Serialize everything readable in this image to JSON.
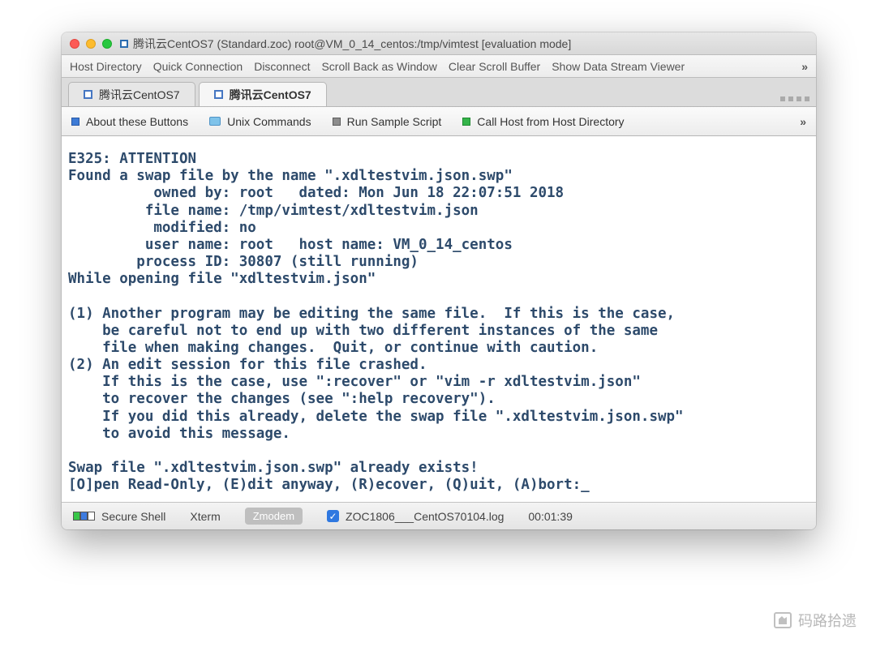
{
  "window": {
    "title": "腾讯云CentOS7 (Standard.zoc) root@VM_0_14_centos:/tmp/vimtest [evaluation mode]"
  },
  "menubar": {
    "items": [
      "Host Directory",
      "Quick Connection",
      "Disconnect",
      "Scroll Back as Window",
      "Clear Scroll Buffer",
      "Show Data Stream Viewer"
    ],
    "more": "»"
  },
  "tabs": {
    "list": [
      {
        "label": "腾讯云CentOS7",
        "active": false
      },
      {
        "label": "腾讯云CentOS7",
        "active": true
      }
    ]
  },
  "button_row": {
    "items": [
      {
        "label": "About these Buttons",
        "icon": "blue"
      },
      {
        "label": "Unix Commands",
        "icon": "folder"
      },
      {
        "label": "Run Sample Script",
        "icon": "gray"
      },
      {
        "label": "Call Host from Host Directory",
        "icon": "green"
      }
    ],
    "more": "»"
  },
  "terminal_text": "E325: ATTENTION\nFound a swap file by the name \".xdltestvim.json.swp\"\n          owned by: root   dated: Mon Jun 18 22:07:51 2018\n         file name: /tmp/vimtest/xdltestvim.json\n          modified: no\n         user name: root   host name: VM_0_14_centos\n        process ID: 30807 (still running)\nWhile opening file \"xdltestvim.json\"\n\n(1) Another program may be editing the same file.  If this is the case,\n    be careful not to end up with two different instances of the same\n    file when making changes.  Quit, or continue with caution.\n(2) An edit session for this file crashed.\n    If this is the case, use \":recover\" or \"vim -r xdltestvim.json\"\n    to recover the changes (see \":help recovery\").\n    If you did this already, delete the swap file \".xdltestvim.json.swp\"\n    to avoid this message.\n\nSwap file \".xdltestvim.json.swp\" already exists!\n[O]pen Read-Only, (E)dit anyway, (R)ecover, (Q)uit, (A)bort:_",
  "statusbar": {
    "conn": "Secure Shell",
    "term": "Xterm",
    "proto": "Zmodem",
    "log": "ZOC1806___CentOS70104.log",
    "time": "00:01:39"
  },
  "watermark": "码路拾遗"
}
